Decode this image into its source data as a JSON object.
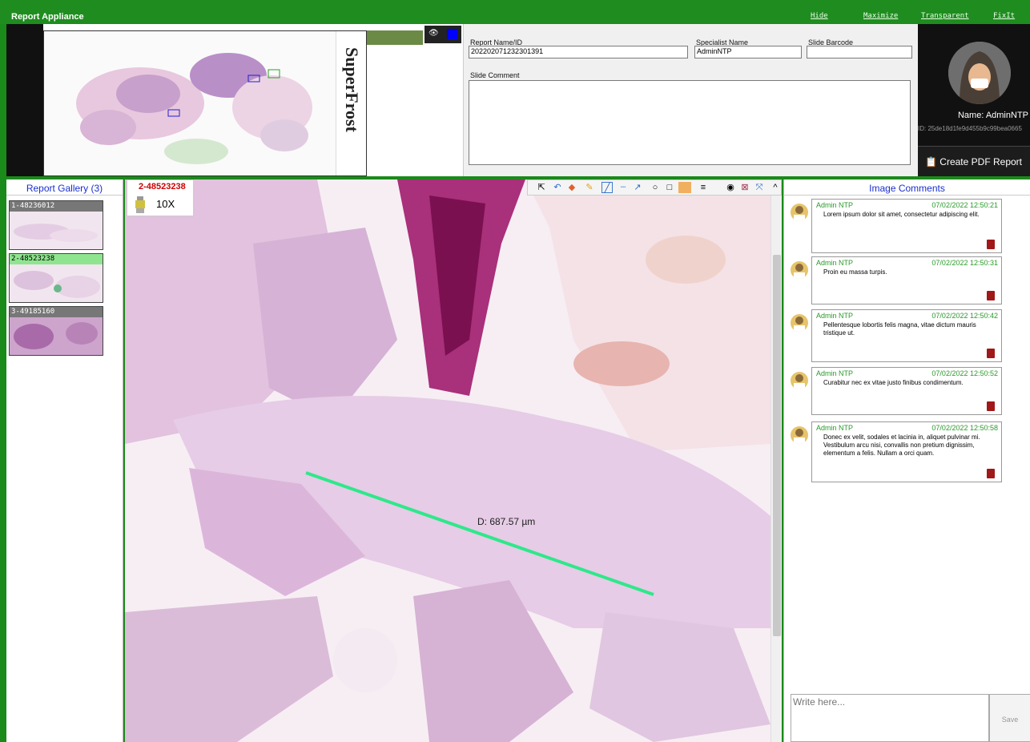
{
  "titlebar": {
    "title": "Report Appliance",
    "hide": "Hide",
    "maximize": "Maximize",
    "transparent": "Transparent",
    "fixit": "FixIt",
    "bg_color": "#1f8c1f"
  },
  "overview": {
    "slide_label": "SuperFrost"
  },
  "form": {
    "report_label": "Report Name/ID",
    "report_value": "202202071232301391",
    "specialist_label": "Specialist Name",
    "specialist_value": "AdminNTP",
    "barcode_label": "Slide Barcode",
    "barcode_value": "",
    "comment_label": "Slide Comment",
    "comment_value": ""
  },
  "user": {
    "name": "Name: AdminNTP",
    "id": "ID: 25de18d1fe9d455b9c99bea0665",
    "pdf_button": "Create PDF Report"
  },
  "gallery": {
    "title": "Report Gallery (3)",
    "items": [
      {
        "label": "1-48236012",
        "active": false
      },
      {
        "label": "2-48523238",
        "active": true
      },
      {
        "label": "3-49185160",
        "active": false
      }
    ]
  },
  "viewer": {
    "slide_id": "2-48523238",
    "zoom": "10X",
    "measurement": "D: 687.57 µm"
  },
  "comments": {
    "title": "Image Comments",
    "items": [
      {
        "author": "Admin NTP",
        "time": "07/02/2022 12:50:21",
        "text": "Lorem ipsum dolor sit amet, consectetur adipiscing elit."
      },
      {
        "author": "Admin NTP",
        "time": "07/02/2022 12:50:31",
        "text": "Proin eu massa turpis."
      },
      {
        "author": "Admin NTP",
        "time": "07/02/2022 12:50:42",
        "text": "Pellentesque lobortis felis magna, vitae dictum mauris tristique ut."
      },
      {
        "author": "Admin NTP",
        "time": "07/02/2022 12:50:52",
        "text": "Curabitur nec ex vitae justo finibus condimentum."
      },
      {
        "author": "Admin NTP",
        "time": "07/02/2022 12:50:58",
        "text": "Donec ex velit, sodales et lacinia in, aliquet pulvinar mi. Vestibulum arcu nisi, convallis non pretium dignissim, elementum a felis. Nullam a orci quam."
      }
    ],
    "write_placeholder": "Write here...",
    "save_label": "Save"
  },
  "colors": {
    "accent_blue": "#1a2fd0",
    "measure_line": "#2ee88a",
    "author_green": "#2a9a2a",
    "slide_id_red": "#cc0000"
  }
}
